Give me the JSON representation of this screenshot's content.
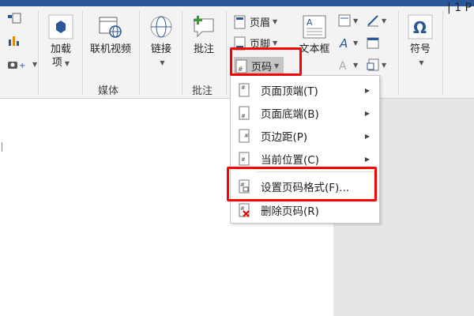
{
  "ribbon": {
    "groups": {
      "media_label": "媒体",
      "comment_label": "批注"
    },
    "buttons": {
      "addins": "加载",
      "addins_sub": "项",
      "online_video": "联机视频",
      "link": "链接",
      "comment": "批注",
      "header": "页眉",
      "footer": "页脚",
      "page_number": "页码",
      "textbox": "文本框",
      "symbol": "符号"
    },
    "title_fragment": "| 1 P"
  },
  "menu": {
    "items": [
      {
        "label": "页面顶端(T)",
        "icon": "page-top-icon",
        "submenu": true
      },
      {
        "label": "页面底端(B)",
        "icon": "page-bottom-icon",
        "submenu": true
      },
      {
        "label": "页边距(P)",
        "icon": "page-margin-icon",
        "submenu": true
      },
      {
        "label": "当前位置(C)",
        "icon": "current-position-icon",
        "submenu": true
      },
      {
        "label": "设置页码格式(F)...",
        "icon": "format-page-number-icon",
        "submenu": false
      },
      {
        "label": "删除页码(R)",
        "icon": "remove-page-number-icon",
        "submenu": false
      }
    ]
  },
  "colors": {
    "accent": "#2b579a",
    "highlight": "#ff0000"
  }
}
